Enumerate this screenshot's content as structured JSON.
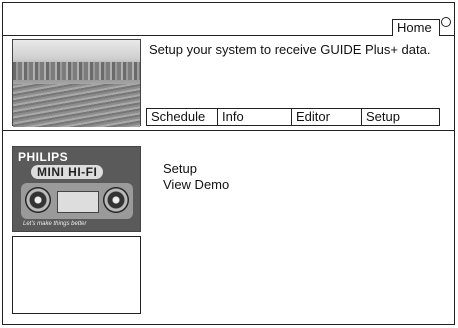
{
  "header": {
    "home_label": "Home",
    "logo_text": "GUIDE Plus+"
  },
  "main": {
    "message": "Setup your system to receive GUIDE Plus+ data.",
    "tabs": [
      {
        "label": "Schedule"
      },
      {
        "label": "Info"
      },
      {
        "label": "Editor"
      },
      {
        "label": "Setup"
      }
    ]
  },
  "sidebar": {
    "ad": {
      "brand": "PHILIPS",
      "product": "MINI HI-FI",
      "tagline": "Let's make things better"
    }
  },
  "menu": {
    "items": [
      {
        "label": "Setup"
      },
      {
        "label": "View Demo"
      }
    ]
  }
}
